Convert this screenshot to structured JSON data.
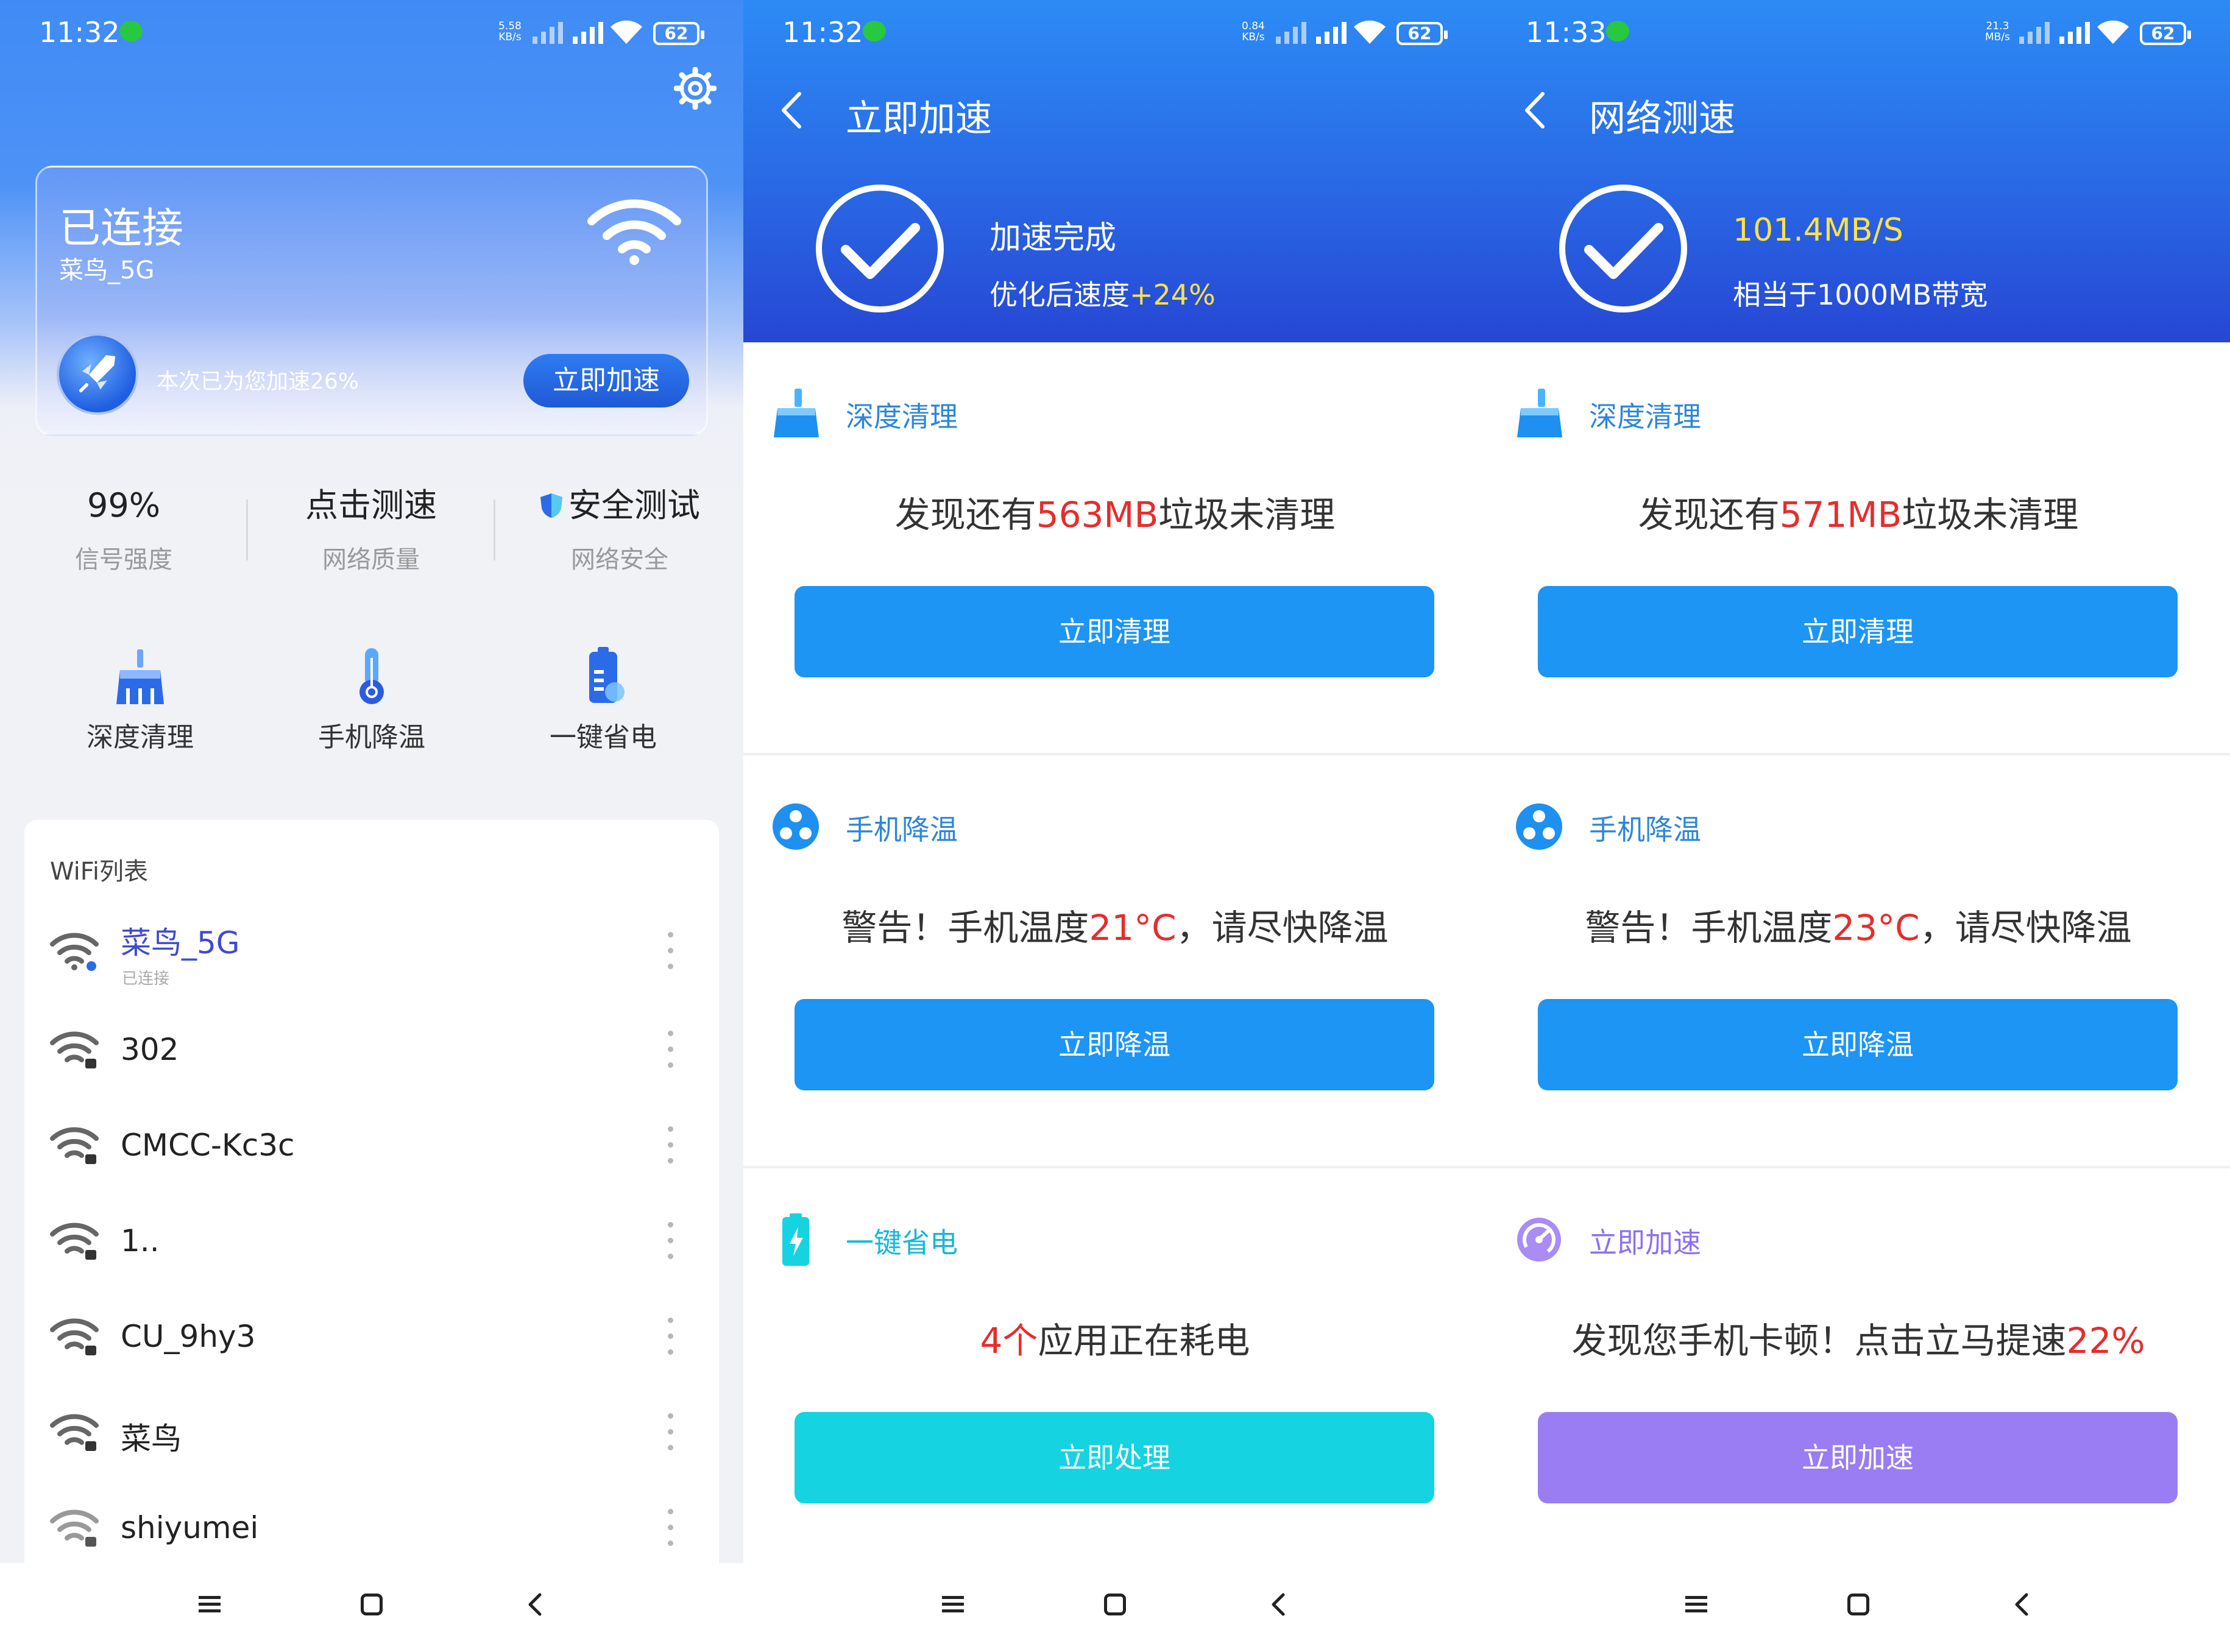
{
  "panels": [
    {
      "status": {
        "time": "11:32",
        "speed": "5.58\nKB/s",
        "battery": "62"
      },
      "card": {
        "title": "已连接",
        "ssid": "菜鸟_5G",
        "message": "本次已为您加速26%",
        "button": "立即加速"
      },
      "stats": [
        {
          "value": "99%",
          "label": "信号强度"
        },
        {
          "value": "点击测速",
          "label": "网络质量"
        },
        {
          "value": "安全测试",
          "label": "网络安全"
        }
      ],
      "tools": [
        {
          "label": "深度清理"
        },
        {
          "label": "手机降温"
        },
        {
          "label": "一键省电"
        }
      ],
      "wifi_list": {
        "title": "WiFi列表",
        "connected_status": "已连接",
        "networks": [
          "菜鸟_5G",
          "302",
          "CMCC-Kc3c",
          "1..",
          "CU_9hy3",
          "菜鸟",
          "shiyumei"
        ]
      }
    },
    {
      "status": {
        "time": "11:32",
        "speed": "0.84\nKB/s",
        "battery": "62"
      },
      "header": {
        "title": "立即加速",
        "main": "加速完成",
        "sub_prefix": "优化后速度",
        "sub_value": "+24%"
      },
      "sections": [
        {
          "title": "深度清理",
          "msg_pre": "发现还有",
          "msg_hl": "563MB",
          "msg_post": "垃圾未清理",
          "button": "立即清理"
        },
        {
          "title": "手机降温",
          "msg_pre": "警告！手机温度",
          "msg_hl": "21°C",
          "msg_post": "，请尽快降温",
          "button": "立即降温"
        },
        {
          "title": "一键省电",
          "msg_pre": "",
          "msg_hl": "4个",
          "msg_post": "应用正在耗电",
          "button": "立即处理"
        }
      ]
    },
    {
      "status": {
        "time": "11:33",
        "speed": "21.3\nMB/s",
        "battery": "62"
      },
      "header": {
        "title": "网络测速",
        "main": "101.4MB/S",
        "sub_prefix": "相当于1000MB带宽",
        "sub_value": ""
      },
      "sections": [
        {
          "title": "深度清理",
          "msg_pre": "发现还有",
          "msg_hl": "571MB",
          "msg_post": "垃圾未清理",
          "button": "立即清理"
        },
        {
          "title": "手机降温",
          "msg_pre": "警告！手机温度",
          "msg_hl": "23°C",
          "msg_post": "，请尽快降温",
          "button": "立即降温"
        },
        {
          "title": "立即加速",
          "msg_pre": "发现您手机卡顿！点击立马提速",
          "msg_hl": "22%",
          "msg_post": "",
          "button": "立即加速"
        }
      ]
    }
  ],
  "colors": {
    "primary_blue": "#1c95f4",
    "header_blue": "#2a6fe8",
    "highlight_red": "#e52d2d",
    "highlight_yellow": "#ffe14a",
    "cyan_button": "#15d3e0",
    "purple_button": "#9a7df2"
  }
}
